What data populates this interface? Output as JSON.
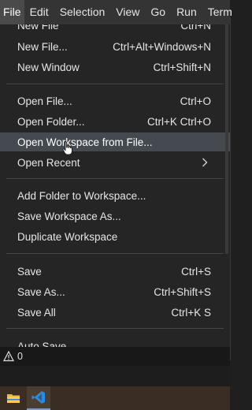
{
  "menubar": {
    "items": [
      {
        "label": "File"
      },
      {
        "label": "Edit"
      },
      {
        "label": "Selection"
      },
      {
        "label": "View"
      },
      {
        "label": "Go"
      },
      {
        "label": "Run"
      },
      {
        "label": "Term"
      }
    ]
  },
  "file_menu": {
    "items": [
      {
        "label": "New File",
        "shortcut": "Ctrl+N"
      },
      {
        "label": "New File...",
        "shortcut": "Ctrl+Alt+Windows+N"
      },
      {
        "label": "New Window",
        "shortcut": "Ctrl+Shift+N"
      },
      {
        "label": "Open File...",
        "shortcut": "Ctrl+O"
      },
      {
        "label": "Open Folder...",
        "shortcut": "Ctrl+K Ctrl+O"
      },
      {
        "label": "Open Workspace from File...",
        "shortcut": ""
      },
      {
        "label": "Open Recent",
        "shortcut": ""
      },
      {
        "label": "Add Folder to Workspace...",
        "shortcut": ""
      },
      {
        "label": "Save Workspace As...",
        "shortcut": ""
      },
      {
        "label": "Duplicate Workspace",
        "shortcut": ""
      },
      {
        "label": "Save",
        "shortcut": "Ctrl+S"
      },
      {
        "label": "Save As...",
        "shortcut": "Ctrl+Shift+S"
      },
      {
        "label": "Save All",
        "shortcut": "Ctrl+K S"
      },
      {
        "label": "Auto Save",
        "shortcut": ""
      }
    ]
  },
  "statusbar": {
    "problems_count": "0"
  },
  "colors": {
    "menu_bg": "#252526",
    "menubar_bg": "#343434",
    "highlight_bg": "#444a4f",
    "vscode_blue": "#2f8ad6"
  }
}
